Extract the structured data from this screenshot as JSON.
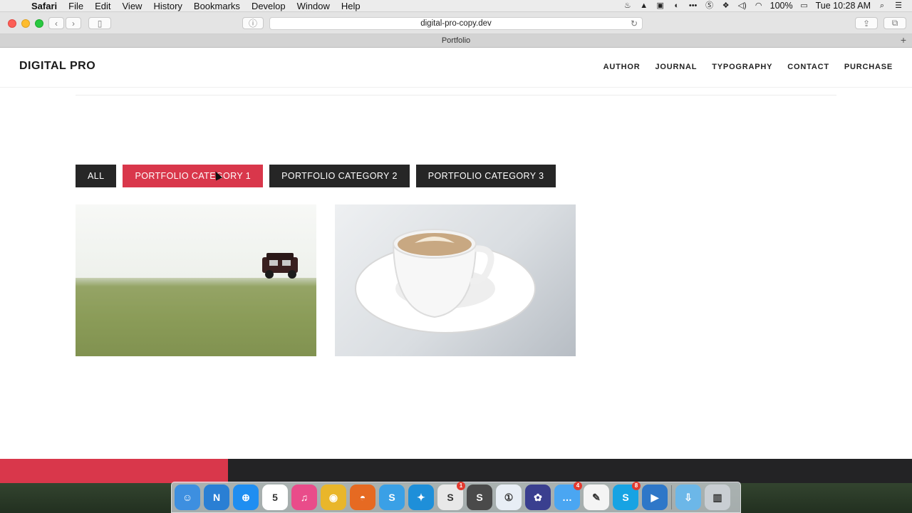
{
  "menubar": {
    "app": "Safari",
    "items": [
      "File",
      "Edit",
      "View",
      "History",
      "Bookmarks",
      "Develop",
      "Window",
      "Help"
    ],
    "battery": "100%",
    "clock": "Tue 10:28 AM"
  },
  "browser": {
    "url": "digital-pro-copy.dev",
    "tab_title": "Portfolio"
  },
  "site": {
    "logo": "DIGITAL PRO",
    "nav": [
      "AUTHOR",
      "JOURNAL",
      "TYPOGRAPHY",
      "CONTACT",
      "PURCHASE"
    ],
    "filters": [
      "ALL",
      "PORTFOLIO CATEGORY 1",
      "PORTFOLIO CATEGORY 2",
      "PORTFOLIO CATEGORY 3"
    ],
    "active_filter": "PORTFOLIO CATEGORY 1",
    "accent_color": "#d9374b",
    "dark_color": "#262626"
  },
  "loading_progress": 0.25,
  "dock": {
    "apps": [
      {
        "name": "finder-icon",
        "color": "#3d8fe0",
        "glyph": "☺"
      },
      {
        "name": "network-icon",
        "color": "#2a7fd4",
        "glyph": "N"
      },
      {
        "name": "safari-icon",
        "color": "#1f8ef1",
        "glyph": "⊕"
      },
      {
        "name": "calendar-icon",
        "color": "#ffffff",
        "glyph": "5"
      },
      {
        "name": "itunes-icon",
        "color": "#e94c8a",
        "glyph": "♫"
      },
      {
        "name": "chrome-icon",
        "color": "#e9b62b",
        "glyph": "◉"
      },
      {
        "name": "firefox-icon",
        "color": "#e66a22",
        "glyph": "◓"
      },
      {
        "name": "skype-like-icon",
        "color": "#3aa0e6",
        "glyph": "S"
      },
      {
        "name": "twitter-icon",
        "color": "#1e8fd9",
        "glyph": "✦"
      },
      {
        "name": "slack-icon",
        "color": "#e8e8e8",
        "glyph": "S",
        "badge": "1"
      },
      {
        "name": "sublime-icon",
        "color": "#4a4a4a",
        "glyph": "S"
      },
      {
        "name": "onepassword-icon",
        "color": "#e8eef5",
        "glyph": "①"
      },
      {
        "name": "tiddlywiki-icon",
        "color": "#3a3f8f",
        "glyph": "✿"
      },
      {
        "name": "messages-icon",
        "color": "#4aa6f2",
        "glyph": "…",
        "badge": "4"
      },
      {
        "name": "textedit-icon",
        "color": "#f4f4f4",
        "glyph": "✎"
      },
      {
        "name": "skype-icon",
        "color": "#17a3e3",
        "glyph": "S",
        "badge": "8"
      },
      {
        "name": "screenflow-icon",
        "color": "#2e77c8",
        "glyph": "▶"
      },
      {
        "name": "downloads-icon",
        "color": "#6cb7e8",
        "glyph": "⇩"
      },
      {
        "name": "trash-icon",
        "color": "#c9ced3",
        "glyph": "▥"
      }
    ]
  }
}
